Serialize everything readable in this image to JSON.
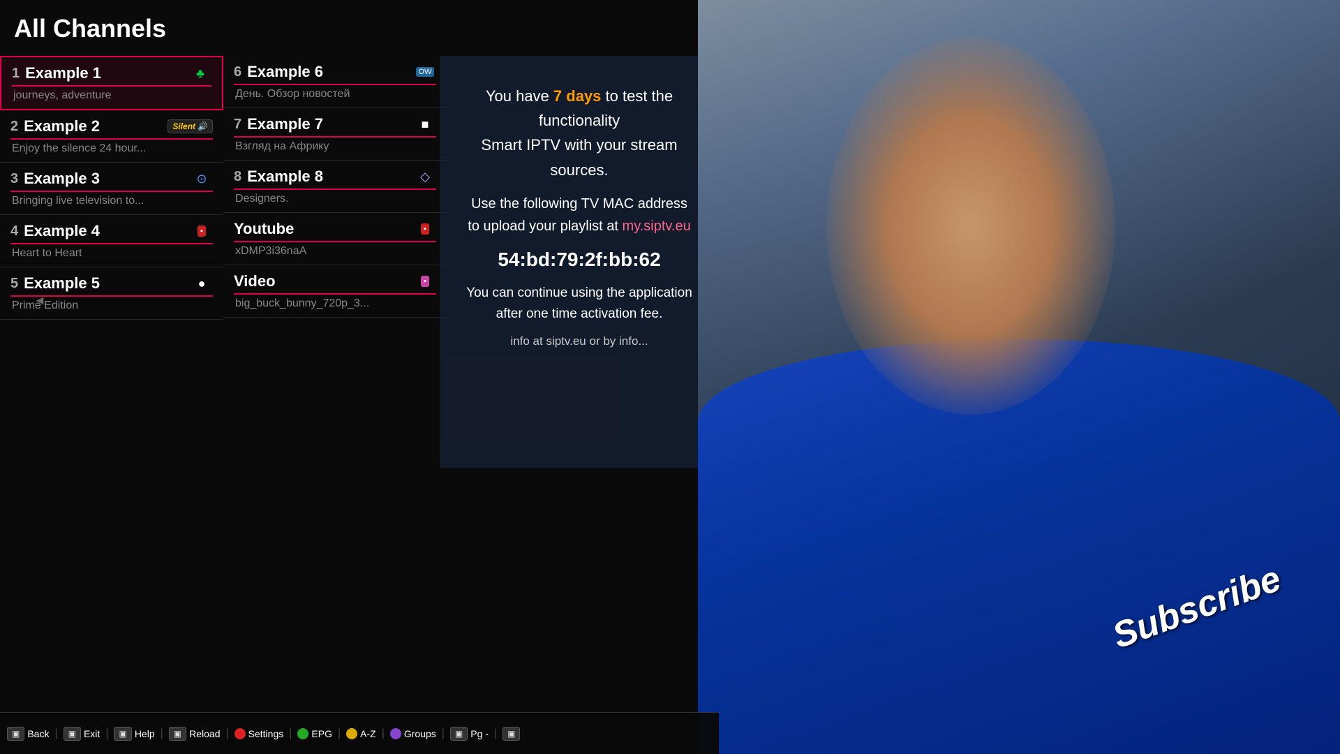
{
  "header": {
    "title": "All Channels"
  },
  "channels_left": [
    {
      "number": "1",
      "name": "Example 1",
      "subtitle": "journeys, adventure",
      "icon": "♣",
      "icon_type": "green",
      "selected": true
    },
    {
      "number": "2",
      "name": "Example 2",
      "subtitle": "Enjoy the silence 24 hour...",
      "icon": "Silent",
      "icon_type": "silent",
      "selected": false
    },
    {
      "number": "3",
      "name": "Example 3",
      "subtitle": "Bringing live television to...",
      "icon": "◎",
      "icon_type": "blue",
      "selected": false
    },
    {
      "number": "4",
      "name": "Example 4",
      "subtitle": "Heart to Heart",
      "icon": "▪",
      "icon_type": "red",
      "selected": false
    },
    {
      "number": "5",
      "name": "Example 5",
      "subtitle": "Prime Edition",
      "icon": "●",
      "icon_type": "white",
      "selected": false
    }
  ],
  "channels_right": [
    {
      "number": "6",
      "name": "Example 6",
      "subtitle": "День. Обзор новостей",
      "icon": "OW",
      "icon_type": "blue_badge",
      "selected": false
    },
    {
      "number": "7",
      "name": "Example 7",
      "subtitle": "Взгляд на Африку",
      "icon": "■",
      "icon_type": "white_sq",
      "selected": false
    },
    {
      "number": "8",
      "name": "Example 8",
      "subtitle": "Designers.",
      "icon": "◇",
      "icon_type": "outline",
      "selected": false
    },
    {
      "number": "",
      "name": "Youtube",
      "subtitle": "xDMP3i36naA",
      "icon": "▪",
      "icon_type": "red_badge",
      "selected": false
    },
    {
      "number": "",
      "name": "Video",
      "subtitle": "big_buck_bunny_720p_3...",
      "icon": "▪",
      "icon_type": "pink_badge",
      "selected": false
    }
  ],
  "info_panel": {
    "line1": "You have ",
    "days": "7 days",
    "line1_end": " to test the functionality",
    "line2": "Smart IPTV with your stream sources.",
    "line3": "Use the following TV MAC address",
    "line4": "to upload your playlist at ",
    "link": "my.siptv.eu",
    "mac": "54:bd:79:2f:bb:62",
    "line5": "You can continue using the application",
    "line6": "after one time activation fee.",
    "line7": "info at siptv.eu or by info..."
  },
  "toolbar": {
    "back_label": "Back",
    "exit_label": "Exit",
    "help_label": "Help",
    "reload_label": "Reload",
    "settings_label": "Settings",
    "epg_label": "EPG",
    "az_label": "A-Z",
    "groups_label": "Groups",
    "pg_label": "Pg -"
  },
  "subscribe_text": "Subscribe"
}
